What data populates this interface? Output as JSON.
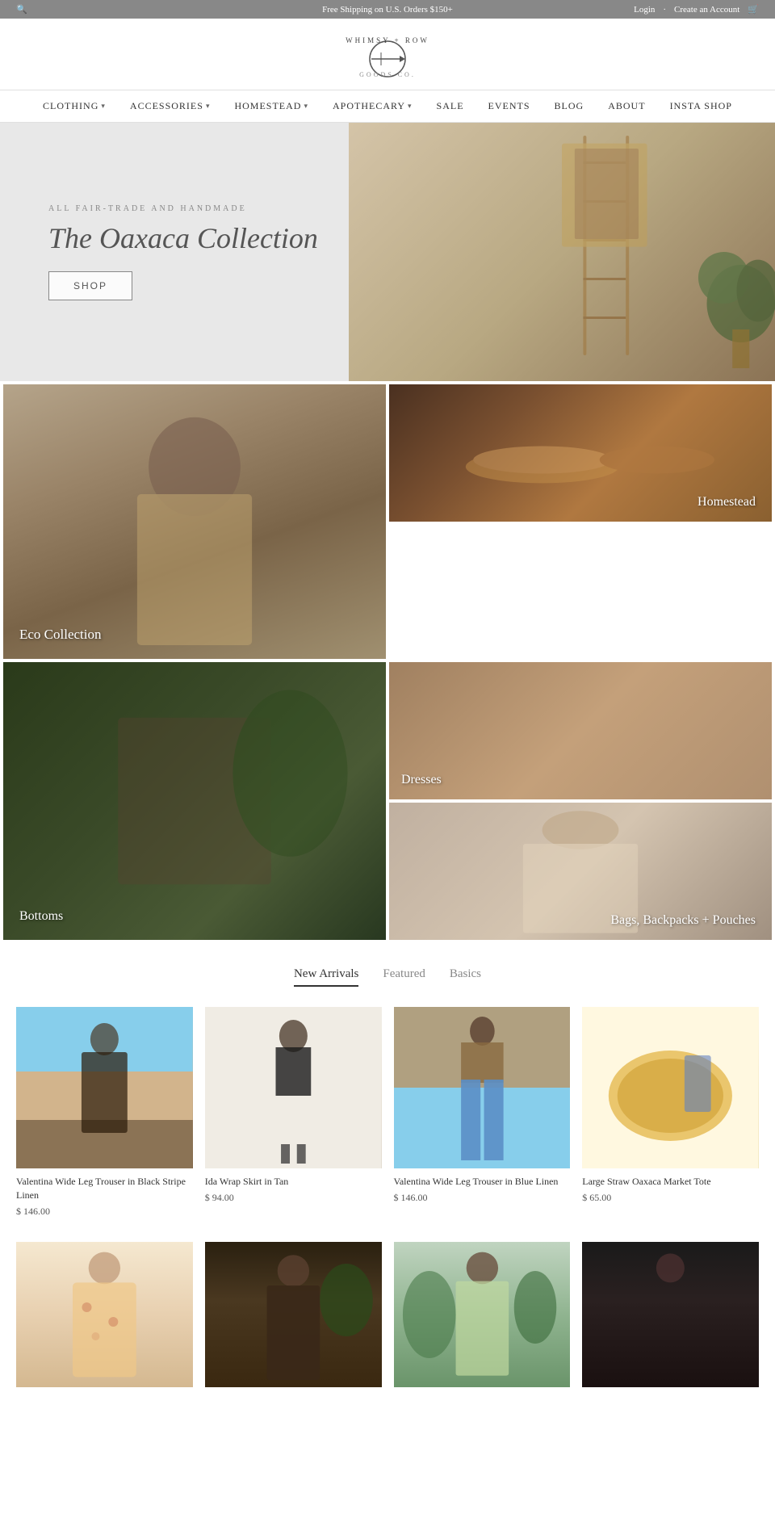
{
  "topbar": {
    "left_icon": "🔍",
    "shipping_text": "Free Shipping on U.S. Orders $150+",
    "login_text": "Login",
    "create_account_text": "Create an Account",
    "cart_icon": "🛒"
  },
  "header": {
    "logo_main": "WHIMSY + ROW",
    "logo_sub": "GOODS CO."
  },
  "nav": {
    "items": [
      {
        "label": "CLOTHING",
        "has_dropdown": true
      },
      {
        "label": "ACCESSORIES",
        "has_dropdown": true
      },
      {
        "label": "HOMESTEAD",
        "has_dropdown": true
      },
      {
        "label": "APOTHECARY",
        "has_dropdown": true
      },
      {
        "label": "SALE",
        "has_dropdown": false
      },
      {
        "label": "EVENTS",
        "has_dropdown": false
      },
      {
        "label": "BLOG",
        "has_dropdown": false
      },
      {
        "label": "ABOUT",
        "has_dropdown": false
      },
      {
        "label": "INSTA SHOP",
        "has_dropdown": false
      }
    ]
  },
  "hero": {
    "subtitle": "ALL FAIR-TRADE AND HANDMADE",
    "title": "The Oaxaca Collection",
    "cta_label": "SHOP"
  },
  "categories": [
    {
      "label": "Eco Collection",
      "size": "tall",
      "bg": "eco-bg",
      "position": "left-tall"
    },
    {
      "label": "Homestead",
      "size": "medium",
      "bg": "homestead-bg",
      "position": "right-top"
    },
    {
      "label": "Bottoms",
      "size": "medium",
      "bg": "bottoms-bg",
      "position": "right-bottom-left"
    },
    {
      "label": "Dresses",
      "size": "medium",
      "bg": "dresses-bg",
      "position": "right-bottom-right"
    },
    {
      "label": "Bags, Backpacks + Pouches",
      "size": "tall-short",
      "bg": "bags-bg",
      "position": "left-bottom"
    }
  ],
  "product_section": {
    "tabs": [
      {
        "label": "New Arrivals",
        "active": true
      },
      {
        "label": "Featured",
        "active": false
      },
      {
        "label": "Basics",
        "active": false
      }
    ],
    "products": [
      {
        "name": "Valentina Wide Leg Trouser in Black Stripe Linen",
        "price": "$ 146.00",
        "bg": "prod-bg-1"
      },
      {
        "name": "Ida Wrap Skirt in Tan",
        "price": "$ 94.00",
        "bg": "prod-bg-2"
      },
      {
        "name": "Valentina Wide Leg Trouser in Blue Linen",
        "price": "$ 146.00",
        "bg": "prod-bg-3"
      },
      {
        "name": "Large Straw Oaxaca Market Tote",
        "price": "$ 65.00",
        "bg": "prod-bg-4"
      }
    ],
    "second_row": [
      {
        "name": "",
        "price": "",
        "bg": "prod-bg-5"
      },
      {
        "name": "",
        "price": "",
        "bg": "prod-bg-6"
      },
      {
        "name": "",
        "price": "",
        "bg": "prod-bg-7"
      },
      {
        "name": "",
        "price": "",
        "bg": "prod-bg-8"
      }
    ]
  }
}
